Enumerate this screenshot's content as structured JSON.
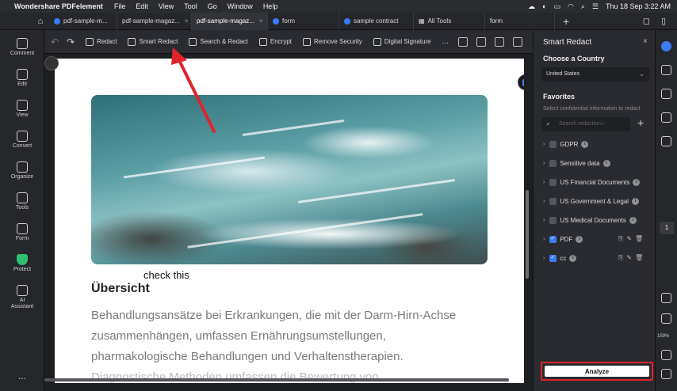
{
  "menubar": {
    "app_name": "Wondershare PDFelement",
    "menus": [
      "File",
      "Edit",
      "View",
      "Tool",
      "Go",
      "Window",
      "Help"
    ],
    "datetime": "Thu 18 Sep  3:22 AM"
  },
  "tabs": [
    {
      "label": "pdf-sample-m..."
    },
    {
      "label": "pdf-sample-magaz..."
    },
    {
      "label": "pdf-sample-magaz..."
    },
    {
      "label": "form"
    },
    {
      "label": "sample contract"
    },
    {
      "label": "All Tools"
    },
    {
      "label": "form"
    }
  ],
  "left_sidebar": {
    "items": [
      "Comment",
      "Edit",
      "View",
      "Convert",
      "Organize",
      "Tools",
      "Form",
      "Protect",
      "AI Assistant"
    ],
    "more": "..."
  },
  "toolbar": {
    "buttons": [
      "Redact",
      "Smart Redact",
      "Search & Redact",
      "Encrypt",
      "Remove Security",
      "Digital Signature"
    ],
    "more": "..."
  },
  "document": {
    "annotation": "check this",
    "heading": "Übersicht",
    "paragraph_lines": [
      "Behandlungsansätze bei Erkrankungen, die mit der Darm-Hirn-Achse",
      "zusammenhängen, umfassen Ernährungsumstellungen,",
      "pharmakologische Behandlungen und Verhaltenstherapien.",
      "Diagnostische Methoden umfassen die Bewertung von"
    ]
  },
  "panel": {
    "title": "Smart Redact",
    "close": "×",
    "country_label": "Choose a Country",
    "country_value": "United States",
    "favorites_label": "Favorites",
    "hint": "Select confidential information to redact",
    "search_placeholder": "Search redaction i",
    "favorites": [
      {
        "label": "GDPR",
        "checked": false
      },
      {
        "label": "Sensitive data",
        "checked": false
      },
      {
        "label": "US Financial Documents",
        "checked": false
      },
      {
        "label": "US Government & Legal",
        "checked": false
      },
      {
        "label": "US Medical Documents",
        "checked": false
      },
      {
        "label": "PDF",
        "checked": true
      },
      {
        "label": "cc",
        "checked": true
      }
    ],
    "analyze_label": "Analyze"
  },
  "right_rail": {
    "page_number": "1",
    "zoom": "159%"
  },
  "colors": {
    "accent": "#3c7bf5",
    "highlight": "#e0222a",
    "protect": "#2fbf71"
  }
}
